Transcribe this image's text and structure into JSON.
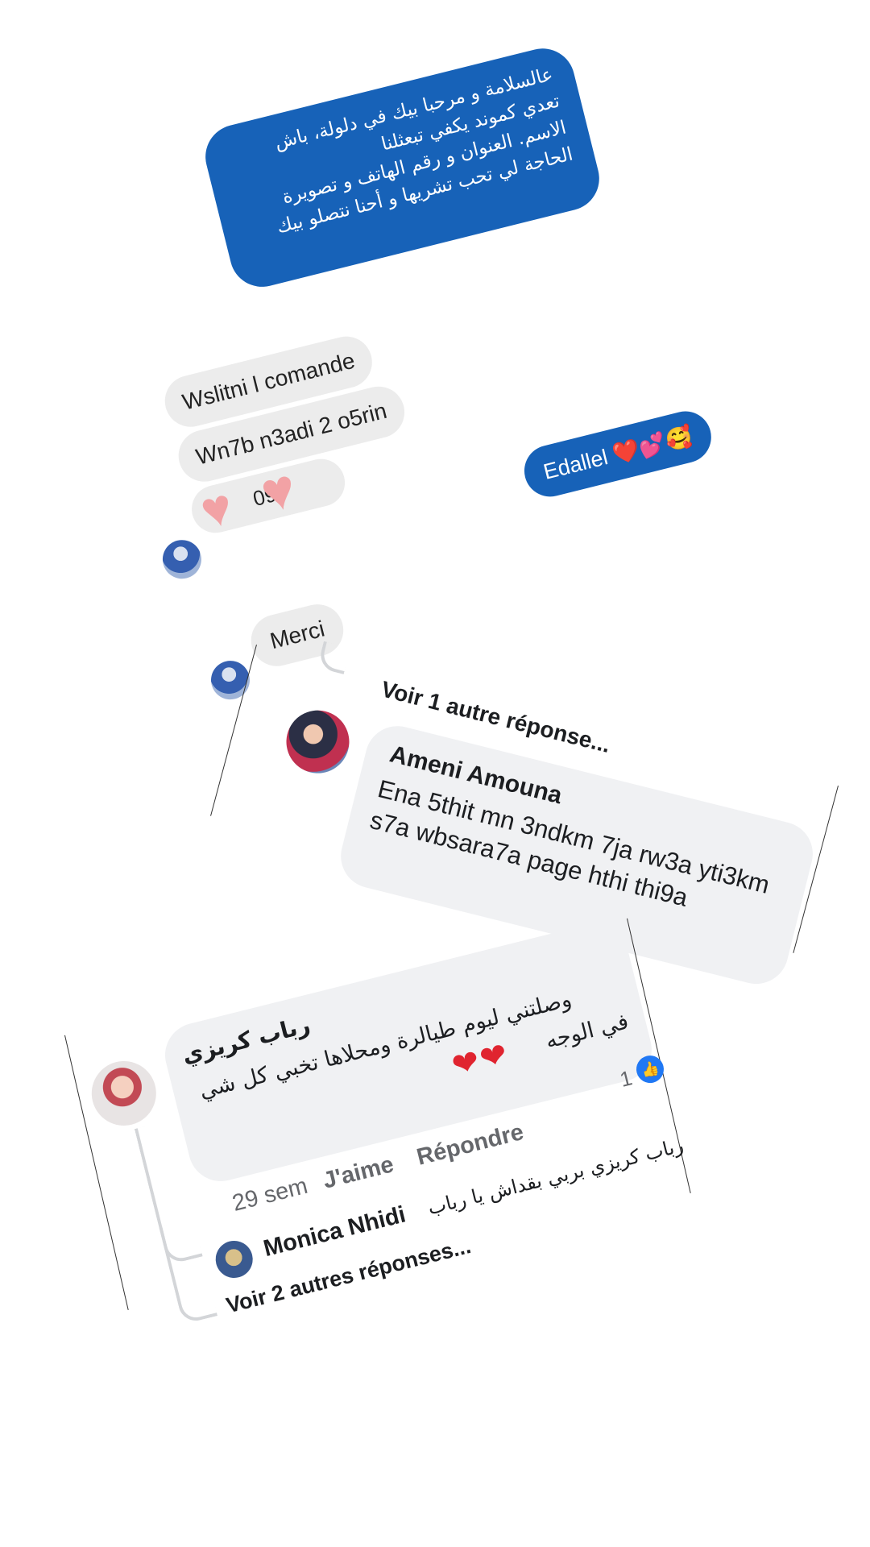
{
  "messenger": {
    "outgoing_message_lines": [
      "عالسلامة و مرحبا بيك في دلولة، باش",
      "تعدي كموند يكفي تبعثلنا",
      "الاسم. العنوان و رقم الهاتف و تصويرة",
      "الحاجة لي تحب تشريها و أحنا نتصلو بيك"
    ],
    "incoming_1": "Wslitni l comande",
    "incoming_2": "Wn7b n3adi 2 o5rin",
    "incoming_3_partial": "09",
    "reply_out": "Edallel ❤️💕🥰",
    "incoming_merci": "Merci"
  },
  "comment_ameni": {
    "view_more": "Voir 1 autre réponse...",
    "author": "Ameni Amouna",
    "text_line1": "Ena 5thit mn 3ndkm 7ja rw3a yti3km",
    "text_line2": "s7a wbsara7a page hthi thi9a"
  },
  "comment_rabab": {
    "author": "رباب كريزي",
    "text_line1": "وصلتني ليوم طيالرة ومحلاها تخبي كل شي",
    "text_line2": "في الوجه",
    "hearts": "❤❤",
    "like_count": "1",
    "time": "29 sem",
    "like_action": "J'aime",
    "reply_action": "Répondre",
    "reply_author": "Monica Nhidi",
    "reply_text": "رباب كريزي بربي بقداش يا رباب",
    "view_more": "Voir 2 autres réponses..."
  },
  "colors": {
    "messenger_blue": "#1762b8",
    "incoming_grey": "#ececec",
    "comment_grey": "#f0f1f3",
    "heart_red": "#e0242f",
    "like_blue": "#2078f4"
  }
}
